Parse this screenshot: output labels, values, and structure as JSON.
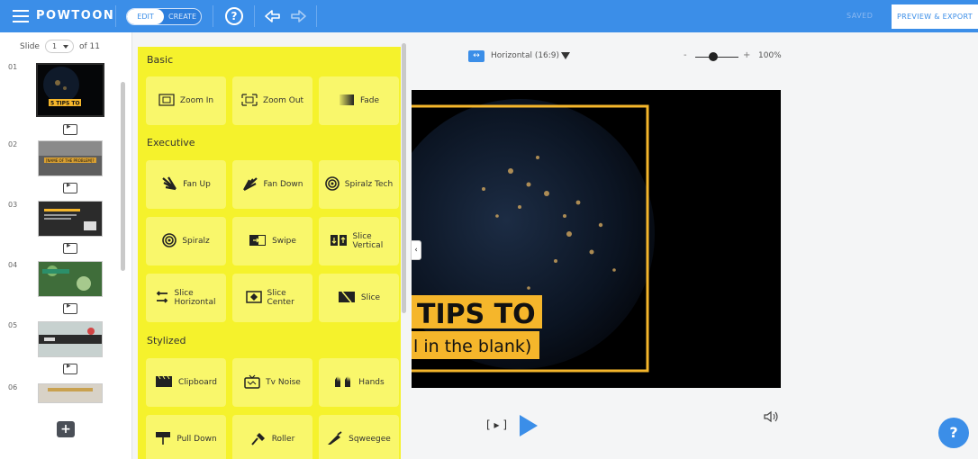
{
  "app": {
    "logo": "POWTOON"
  },
  "toolbar": {
    "edit_label": "EDIT",
    "create_label": "CREATE",
    "help_label": "?",
    "saved_label": "SAVED",
    "preview_label": "PREVIEW & EXPORT"
  },
  "slides": {
    "label": "Slide",
    "current": "1",
    "of_label": "of 11",
    "numbers": [
      "01",
      "02",
      "03",
      "04",
      "05",
      "06"
    ],
    "add_label": "+",
    "thumb1_text": "5 TIPS TO",
    "thumb2_text": "[NAME OF THE PROBLEM]?"
  },
  "transitions": {
    "sections": [
      {
        "title": "Basic",
        "items": [
          "Zoom In",
          "Zoom Out",
          "Fade"
        ]
      },
      {
        "title": "Executive",
        "items": [
          "Fan Up",
          "Fan Down",
          "Spiralz Tech",
          "Spiralz",
          "Swipe",
          "Slice Vertical",
          "Slice Horizontal",
          "Slice Center",
          "Slice"
        ]
      },
      {
        "title": "Stylized",
        "items": [
          "Clipboard",
          "Tv Noise",
          "Hands",
          "Pull Down",
          "Roller",
          "Sqweegee"
        ]
      }
    ]
  },
  "canvas": {
    "aspect_label": "Horizontal (16:9)",
    "zoom_minus": "-",
    "zoom_plus": "+",
    "zoom_value": "100%",
    "stage_title": "TIPS TO",
    "stage_subtitle": "l in the blank)",
    "play_brackets": "[ ▸ ]",
    "collapse_label": "‹",
    "volume_icon": "speaker-icon"
  },
  "help_fab": "?",
  "colors": {
    "brand": "#3b8ee8",
    "transition_bg": "#f5f22c",
    "accent": "#f5b62b"
  }
}
